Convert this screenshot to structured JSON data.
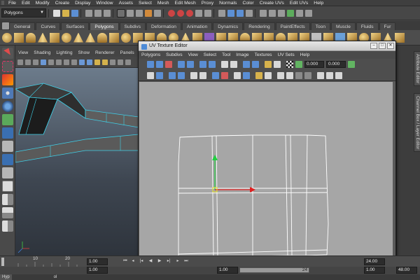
{
  "menubar": {
    "items": [
      "File",
      "Edit",
      "Modify",
      "Create",
      "Display",
      "Window",
      "Assets",
      "Select",
      "Mesh",
      "Edit Mesh",
      "Proxy",
      "Normals",
      "Color",
      "Create UVs",
      "Edit UVs",
      "Help"
    ]
  },
  "statusline": {
    "mode": "Polygons"
  },
  "shelf": {
    "tabs": [
      "General",
      "Curves",
      "Surfaces",
      "Polygons",
      "Subdivs",
      "Deformation",
      "Animation",
      "Dynamics",
      "Rendering",
      "PaintEffects",
      "Toon",
      "Muscle",
      "Fluids",
      "Fur"
    ],
    "active_tab": "Polygons"
  },
  "viewport": {
    "menu": [
      "View",
      "Shading",
      "Lighting",
      "Show",
      "Renderer",
      "Panels"
    ]
  },
  "right_strip": {
    "tabs": [
      "Attribute Editor",
      "Channel Box / Layer Editor"
    ]
  },
  "uv_editor": {
    "title": "UV Texture Editor",
    "menu": [
      "Polygons",
      "Subdivs",
      "View",
      "Select",
      "Tool",
      "Image",
      "Textures",
      "UV Sets",
      "Help"
    ],
    "field1": "0.000",
    "field2": "0.000"
  },
  "time_slider": {
    "ticks": [
      "10",
      "20"
    ],
    "current_frame": "1.00",
    "frame_field_right": "24.00",
    "range_start": "1.00",
    "range_inner_start": "1.00",
    "range_inner_end": "24",
    "end_frame": "48.00"
  },
  "command_line": {
    "label": "Hyp",
    "text": "ol"
  },
  "colors": {
    "uv_canvas": "#a6a6a6",
    "uv_wire": "#ffffff",
    "manip_x": "#e02020",
    "manip_y": "#20d040",
    "highlight_wire": "#3fd0e8"
  }
}
